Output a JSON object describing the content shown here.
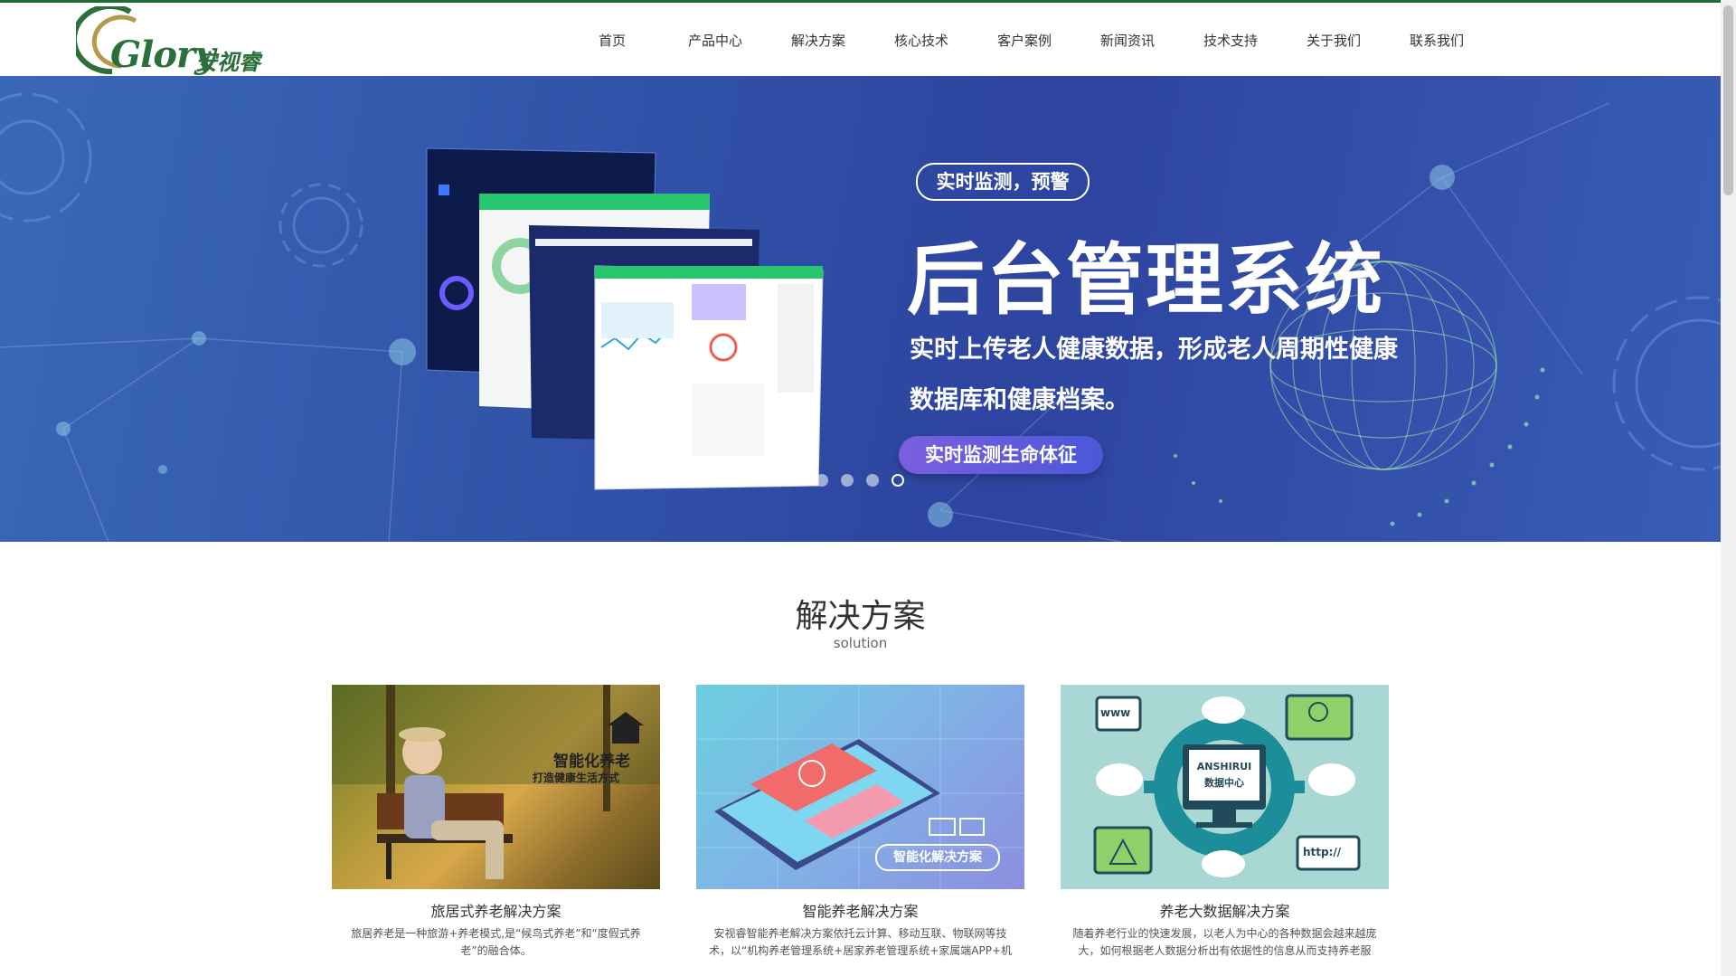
{
  "header": {
    "logo_en": "Glory",
    "logo_cn": "安视睿",
    "nav": [
      "首页",
      "产品中心",
      "解决方案",
      "核心技术",
      "客户案例",
      "新闻资讯",
      "技术支持",
      "关于我们",
      "联系我们"
    ]
  },
  "banner": {
    "tag": "实时监测，预警",
    "title": "后台管理系统",
    "description": "实时上传老人健康数据，形成老人周期性健康数据库和健康档案。",
    "cta": "实时监测生命体征",
    "slides": 4,
    "active_slide": 4
  },
  "solutions": {
    "title": "解决方案",
    "subtitle": "solution",
    "cards": [
      {
        "title": "旅居式养老解决方案",
        "desc": "旅居养老是一种旅游+养老模式,是“候鸟式养老”和“度假式养老”的融合体。",
        "img_text_1": "智能化养老",
        "img_text_2": "打造健康生活方式"
      },
      {
        "title": "智能养老解决方案",
        "desc": "安视睿智能养老解决方案依托云计算、移动互联、物联网等技术，以“机构养老管理系统+居家养老管理系统+家属端APP+机构端",
        "img_text_1": "智能化解决方案"
      },
      {
        "title": "养老大数据解决方案",
        "desc": "随着养老行业的快速发展，以老人为中心的各种数据会越来越庞大，如何根据老人数据分析出有依据性的信息从而支持养老服",
        "img_text_1": "ANSHIRUI",
        "img_text_2": "数据中心",
        "img_text_3": "www",
        "img_text_4": "http://"
      }
    ]
  },
  "colors": {
    "brand_green": "#2b6f3b",
    "banner_blue": "#3152a8",
    "cta_purple": "#7a5fe0"
  }
}
